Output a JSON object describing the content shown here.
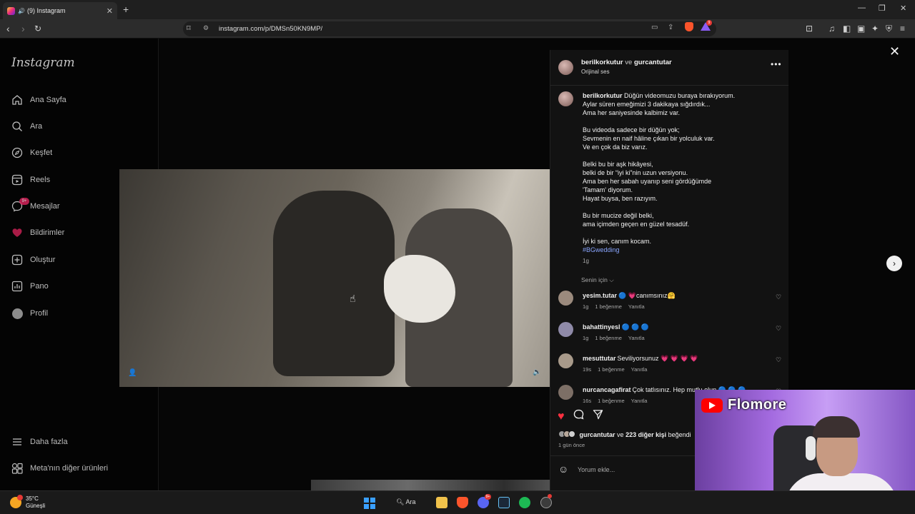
{
  "browser": {
    "tab_title": "(9) Instagram",
    "new_tab": "+",
    "url": "instagram.com/p/DMSn50KN9MP/",
    "notification_count": "9"
  },
  "sidebar": {
    "logo": "Instagram",
    "items": [
      {
        "label": "Ana Sayfa",
        "icon": "home-icon"
      },
      {
        "label": "Ara",
        "icon": "search-icon"
      },
      {
        "label": "Keşfet",
        "icon": "compass-icon"
      },
      {
        "label": "Reels",
        "icon": "reels-icon"
      },
      {
        "label": "Mesajlar",
        "icon": "messenger-icon"
      },
      {
        "label": "Bildirimler",
        "icon": "heart-icon"
      },
      {
        "label": "Oluştur",
        "icon": "plus-square-icon"
      },
      {
        "label": "Pano",
        "icon": "dashboard-icon"
      },
      {
        "label": "Profil",
        "icon": "avatar"
      }
    ],
    "messages_badge": "9+",
    "more": "Daha fazla",
    "meta": "Meta'nın diğer ürünleri"
  },
  "post": {
    "author": "berilkorkutur",
    "connector": "ve",
    "coauthor": "gurcantutar",
    "audio": "Orijinal ses",
    "caption_author": "berilkorkutur",
    "caption_lines": [
      "Düğün videomuzu buraya bırakıyorum.",
      "Aylar süren emeğimizi 3 dakikaya sığdırdık...",
      "Ama her saniyesinde kalbimiz var.",
      "",
      "Bu videoda sadece bir düğün yok;",
      "Sevmenin en naif hâline çıkan bir yolculuk var.",
      "Ve en çok da biz varız.",
      "",
      "Belki bu bir aşk hikâyesi,",
      "belki de bir “iyi ki”nin uzun versiyonu.",
      "Ama ben her sabah uyanıp seni gördüğümde",
      "'Tamam' diyorum.",
      "Hayat buysa, ben razıyım.",
      "",
      "Bu bir mucize değil belki,",
      "ama içimden geçen en güzel tesadüf.",
      "",
      "İyi ki sen, canım kocam."
    ],
    "hashtag": "#BGwedding",
    "caption_time": "1g",
    "filter": "Senin için ⌵",
    "comments": [
      {
        "user": "yesim.tutar",
        "text": "🔵 💗canımsınız🤗",
        "time": "1g",
        "likes": "1 beğenme",
        "reply": "Yanıtla"
      },
      {
        "user": "bahattinyesl",
        "text": "🔵 🔵 🔵",
        "time": "1g",
        "likes": "1 beğenme",
        "reply": "Yanıtla"
      },
      {
        "user": "mesuttutar",
        "text": "Seviliyorsunuz 💗 💗 💗 💗",
        "time": "19s",
        "likes": "1 beğenme",
        "reply": "Yanıtla"
      },
      {
        "user": "nurcancagafirat",
        "text": "Çok tatlısınız. Hep mutlu olun 🔵 🔵 🔵",
        "time": "16s",
        "likes": "1 beğenme",
        "reply": "Yanıtla"
      }
    ],
    "liked_by_user": "gurcantutar",
    "liked_connector": "ve",
    "liked_others": "223 diğer kişi",
    "liked_suffix": "beğendi",
    "posted_ago": "1 gün önce",
    "add_comment_placeholder": "Yorum ekle..."
  },
  "stream": {
    "channel": "Flomore"
  },
  "taskbar": {
    "temperature": "35°C",
    "condition": "Güneşli",
    "search": "Ara",
    "discord_badge": "9+"
  },
  "colors": {
    "instagram_bg": "#040404",
    "panel_bg": "#121212",
    "like_red": "#ff3040",
    "link_blue": "#8aa6ff",
    "youtube_red": "#ff0000"
  }
}
